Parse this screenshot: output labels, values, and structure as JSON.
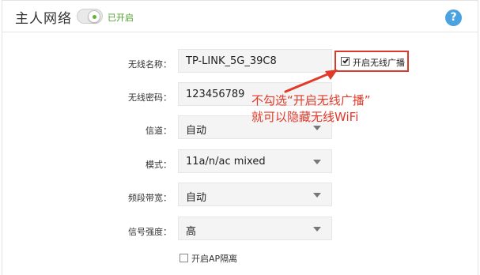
{
  "section": {
    "title": "主人网络",
    "toggle_on": true,
    "status": "已开启"
  },
  "help": {
    "symbol": "?"
  },
  "form": {
    "ssid": {
      "label": "无线名称：",
      "value": "TP-LINK_5G_39C8"
    },
    "password": {
      "label": "无线密码：",
      "value": "123456789"
    },
    "channel": {
      "label": "信道：",
      "value": "自动"
    },
    "mode": {
      "label": "模式：",
      "value": "11a/n/ac mixed"
    },
    "bandwidth": {
      "label": "频段带宽：",
      "value": "自动"
    },
    "signal": {
      "label": "信号强度：",
      "value": "高"
    },
    "broadcast": {
      "label": "开启无线广播",
      "checked": true
    },
    "ap_isolation": {
      "label": "开启AP隔离",
      "checked": false
    }
  },
  "annotation": {
    "line1": "不勾选“开启无线广播”",
    "line2": "就可以隐藏无线WiFi",
    "color": "#e23a2a"
  },
  "colors": {
    "accent_green": "#62b532",
    "help_blue": "#4aa3e0",
    "highlight_red": "#d93a2b"
  }
}
